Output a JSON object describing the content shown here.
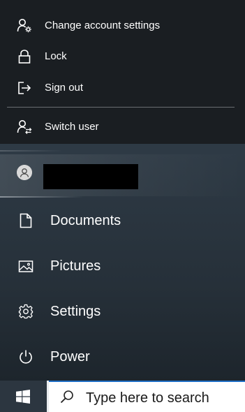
{
  "account_flyout": {
    "items": [
      {
        "label": "Change account settings",
        "icon": "account-settings-icon"
      },
      {
        "label": "Lock",
        "icon": "lock-icon"
      },
      {
        "label": "Sign out",
        "icon": "sign-out-icon"
      },
      {
        "label": "Switch user",
        "icon": "switch-user-icon"
      }
    ]
  },
  "user": {
    "avatar_icon": "avatar-icon"
  },
  "menu": {
    "items": [
      {
        "label": "Documents",
        "icon": "document-icon"
      },
      {
        "label": "Pictures",
        "icon": "pictures-icon"
      },
      {
        "label": "Settings",
        "icon": "gear-icon"
      },
      {
        "label": "Power",
        "icon": "power-icon"
      }
    ]
  },
  "taskbar": {
    "start_icon": "windows-logo-icon",
    "search": {
      "placeholder": "Type here to search",
      "icon": "search-icon"
    }
  },
  "colors": {
    "flyout_bg": "#1a1e22",
    "menu_bg": "#2e3a45",
    "taskbar_bg": "#2c3640",
    "search_accent": "#1f6fc6"
  }
}
